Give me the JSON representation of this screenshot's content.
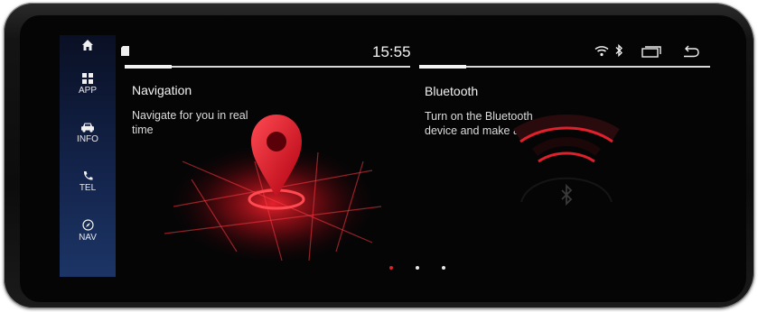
{
  "status_bar": {
    "time": "15:55",
    "icons": [
      "sd-card-icon",
      "wifi-icon",
      "bluetooth-icon",
      "recent-apps-icon",
      "back-icon"
    ]
  },
  "sidebar": {
    "items": [
      {
        "label": "",
        "icon": "home-icon"
      },
      {
        "label": "APP",
        "icon": "app-grid-icon"
      },
      {
        "label": "INFO",
        "icon": "car-icon"
      },
      {
        "label": "TEL",
        "icon": "phone-icon"
      },
      {
        "label": "NAV",
        "icon": "compass-icon"
      }
    ]
  },
  "cards": [
    {
      "title": "Navigation",
      "description": "Navigate for you in real time"
    },
    {
      "title": "Bluetooth",
      "description": "Turn on the Bluetooth device and make a"
    }
  ],
  "pager": {
    "count": 3,
    "active": 1
  },
  "colors": {
    "accent": "#e0202a",
    "sidebar": "#13234a",
    "text": "#f2f2f2",
    "background": "#050506"
  }
}
